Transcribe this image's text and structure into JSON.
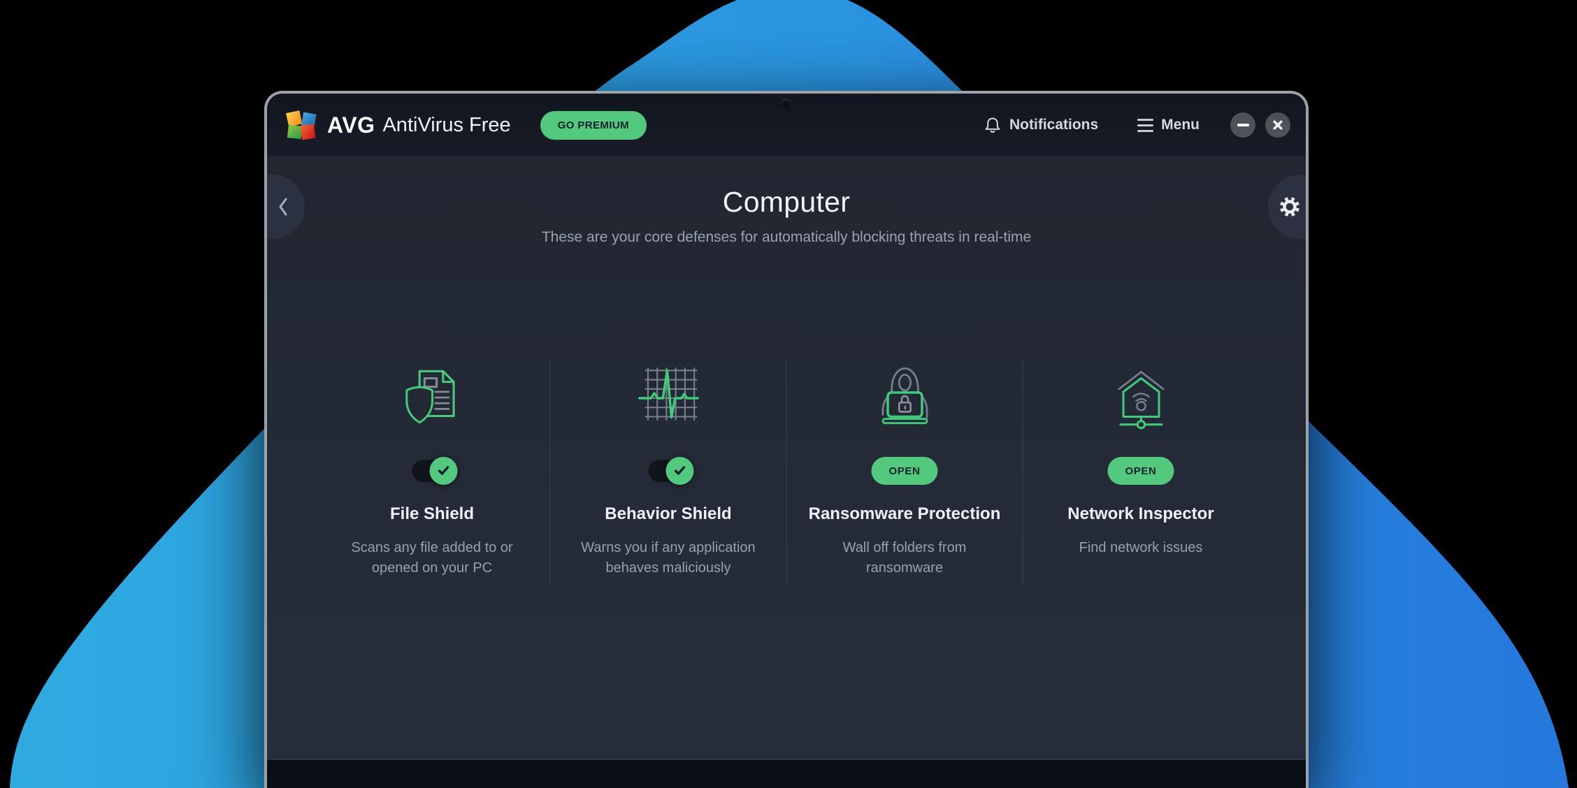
{
  "window": {
    "brand": {
      "name_bold": "AVG",
      "name_rest": "AntiVirus Free"
    },
    "titlebar": {
      "go_premium": "GO PREMIUM",
      "notifications": "Notifications",
      "menu": "Menu"
    },
    "page": {
      "title": "Computer",
      "subtitle": "These are your core defenses for automatically blocking threats in real-time"
    },
    "cards": [
      {
        "icon": "file-shield-icon",
        "title": "File Shield",
        "description": "Scans any file added to or opened on your PC",
        "control": "toggle",
        "state": "on"
      },
      {
        "icon": "behavior-shield-icon",
        "title": "Behavior Shield",
        "description": "Warns you if any application behaves maliciously",
        "control": "toggle",
        "state": "on"
      },
      {
        "icon": "ransomware-protection-icon",
        "title": "Ransomware Protection",
        "description": "Wall off folders from ransomware",
        "control": "button",
        "action_label": "OPEN"
      },
      {
        "icon": "network-inspector-icon",
        "title": "Network Inspector",
        "description": "Find network issues",
        "control": "button",
        "action_label": "OPEN"
      }
    ]
  },
  "icons": {
    "bell": "bell-icon",
    "hamburger": "menu-hamburger-icon",
    "minimize": "minimize-icon",
    "close": "close-icon",
    "back": "chevron-left-icon",
    "settings": "gear-icon",
    "toggle_check": "checkmark-icon",
    "camera": "camera-dot"
  },
  "colors": {
    "accent_green": "#53c97e",
    "blob_gradient_left": "#2fabe1",
    "blob_gradient_right": "#2577dc",
    "window_border": "#9da2a9",
    "titlebar_bg": "#151a24",
    "content_bg": "#242a37",
    "footer_bg": "#0a0e16",
    "background": "#000000"
  }
}
